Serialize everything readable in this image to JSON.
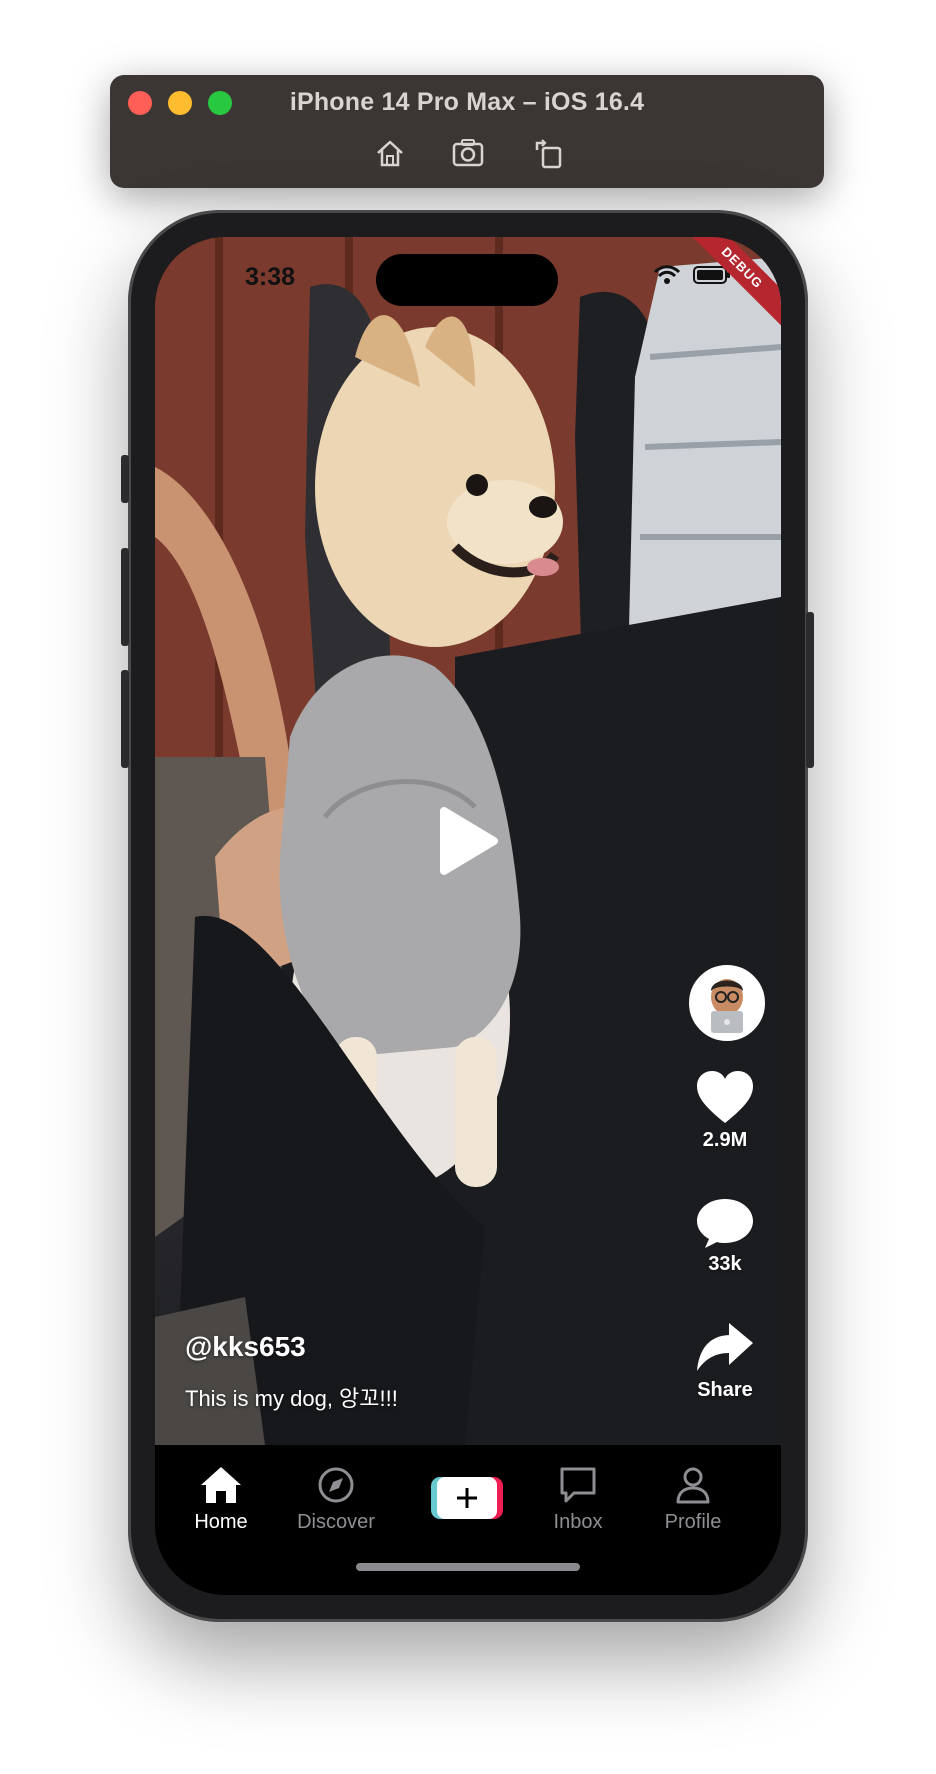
{
  "simulator": {
    "title": "iPhone 14 Pro Max – iOS 16.4",
    "buttons": [
      {
        "icon": "home-icon"
      },
      {
        "icon": "screenshot-icon"
      },
      {
        "icon": "rotate-icon"
      }
    ]
  },
  "status_bar": {
    "time": "3:38",
    "debug_banner": "DEBUG"
  },
  "video": {
    "username": "@kks653",
    "description": "This is my dog, 앙꼬!!!",
    "likes": "2.9M",
    "comments": "33k",
    "share_label": "Share",
    "play_icon": "play-icon"
  },
  "tab_bar": {
    "items": [
      {
        "label": "Home",
        "icon": "home-icon",
        "active": true
      },
      {
        "label": "Discover",
        "icon": "compass-icon",
        "active": false
      },
      {
        "label": "",
        "icon": "add-icon",
        "active": false
      },
      {
        "label": "Inbox",
        "icon": "message-icon",
        "active": false
      },
      {
        "label": "Profile",
        "icon": "person-icon",
        "active": false
      }
    ]
  },
  "colors": {
    "tab_active": "#ffffff",
    "tab_inactive": "#8e8e93",
    "create_cyan": "#69c9d0",
    "create_red": "#ee1d52",
    "debug_red": "#b5262e"
  }
}
